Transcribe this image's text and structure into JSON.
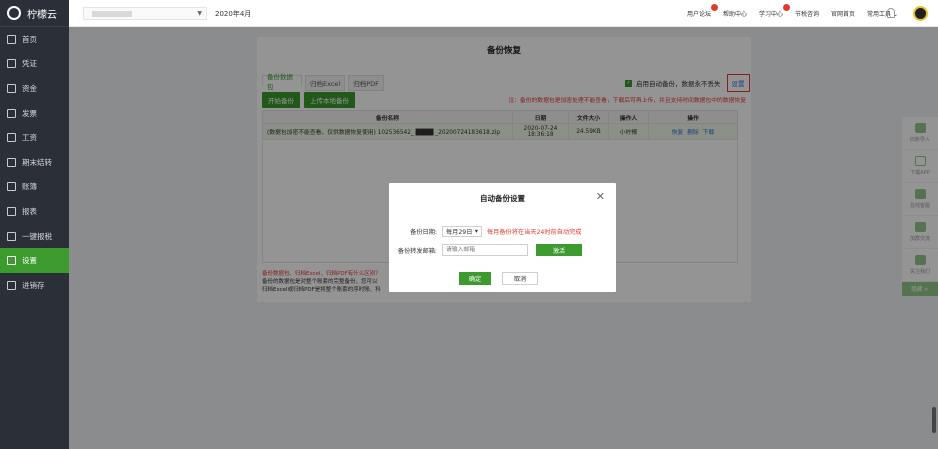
{
  "app": {
    "name": "柠檬云"
  },
  "sidebar": {
    "items": [
      {
        "label": "首页",
        "icon": "home-icon"
      },
      {
        "label": "凭证",
        "icon": "voucher-icon"
      },
      {
        "label": "资金",
        "icon": "fund-icon"
      },
      {
        "label": "发票",
        "icon": "invoice-icon"
      },
      {
        "label": "工资",
        "icon": "salary-icon"
      },
      {
        "label": "期末结转",
        "icon": "period-end-icon"
      },
      {
        "label": "账簿",
        "icon": "ledger-icon"
      },
      {
        "label": "报表",
        "icon": "report-icon"
      },
      {
        "label": "一键报税",
        "icon": "tax-icon"
      },
      {
        "label": "设置",
        "icon": "gear-icon"
      },
      {
        "label": "进销存",
        "icon": "inventory-icon"
      }
    ],
    "active": "设置"
  },
  "topbar": {
    "period": "2020年4月",
    "links": [
      "用户论坛",
      "帮助中心",
      "学习中心",
      "节税咨询",
      "官网首页",
      "常用工具"
    ]
  },
  "page": {
    "title": "备份恢复",
    "tabs": [
      "备份数据包",
      "归档Excel",
      "归档PDF"
    ],
    "auto_backup_label": "启用自动备份，数据永不丢失",
    "settings_link": "设置",
    "buttons": {
      "start": "开始备份",
      "upload": "上传本地备份"
    },
    "tip": "注：备份的数据包是加密处理不能查看，下载后可再上传，并且支持时间数据包中的数据恢复",
    "table": {
      "headers": [
        "备份名称",
        "日期",
        "文件大小",
        "操作人",
        "操作"
      ],
      "rows": [
        {
          "name": "(数据包加密不能查看，仅供数据恢复使用) 102536542_ ████ _20200724183618.zip",
          "date": "2020-07-24 18:36:18",
          "size": "24.59KB",
          "operator": "小柠檬",
          "actions": [
            "恢复",
            "删除",
            "下载"
          ]
        }
      ]
    },
    "notes": {
      "heading": "备份数据包、归档Excel、归档PDF有什么区别？",
      "line1": "备份的数据包是对整个账套的完整备份，您可以",
      "line2": "归档Excel或归档PDF是将整个账套的序时账、科"
    }
  },
  "modal": {
    "title": "自动备份设置",
    "date_label": "备份日期:",
    "date_value": "每月29日",
    "date_hint": "每月备份将在当天24时前自动完成",
    "email_label": "备份转发邮箱:",
    "email_placeholder": "请输入邮箱",
    "activate": "激活",
    "ok": "确定",
    "cancel": "取消"
  },
  "right_tools": [
    {
      "label": "旧账导入"
    },
    {
      "label": "下载APP"
    },
    {
      "label": "在线客服"
    },
    {
      "label": "加群交流"
    },
    {
      "label": "关注我们"
    }
  ],
  "right_tools_more": "隐藏 >",
  "colors": {
    "accent": "#3c9a2f",
    "warning": "#e23b2e",
    "link": "#2d6fd6"
  }
}
